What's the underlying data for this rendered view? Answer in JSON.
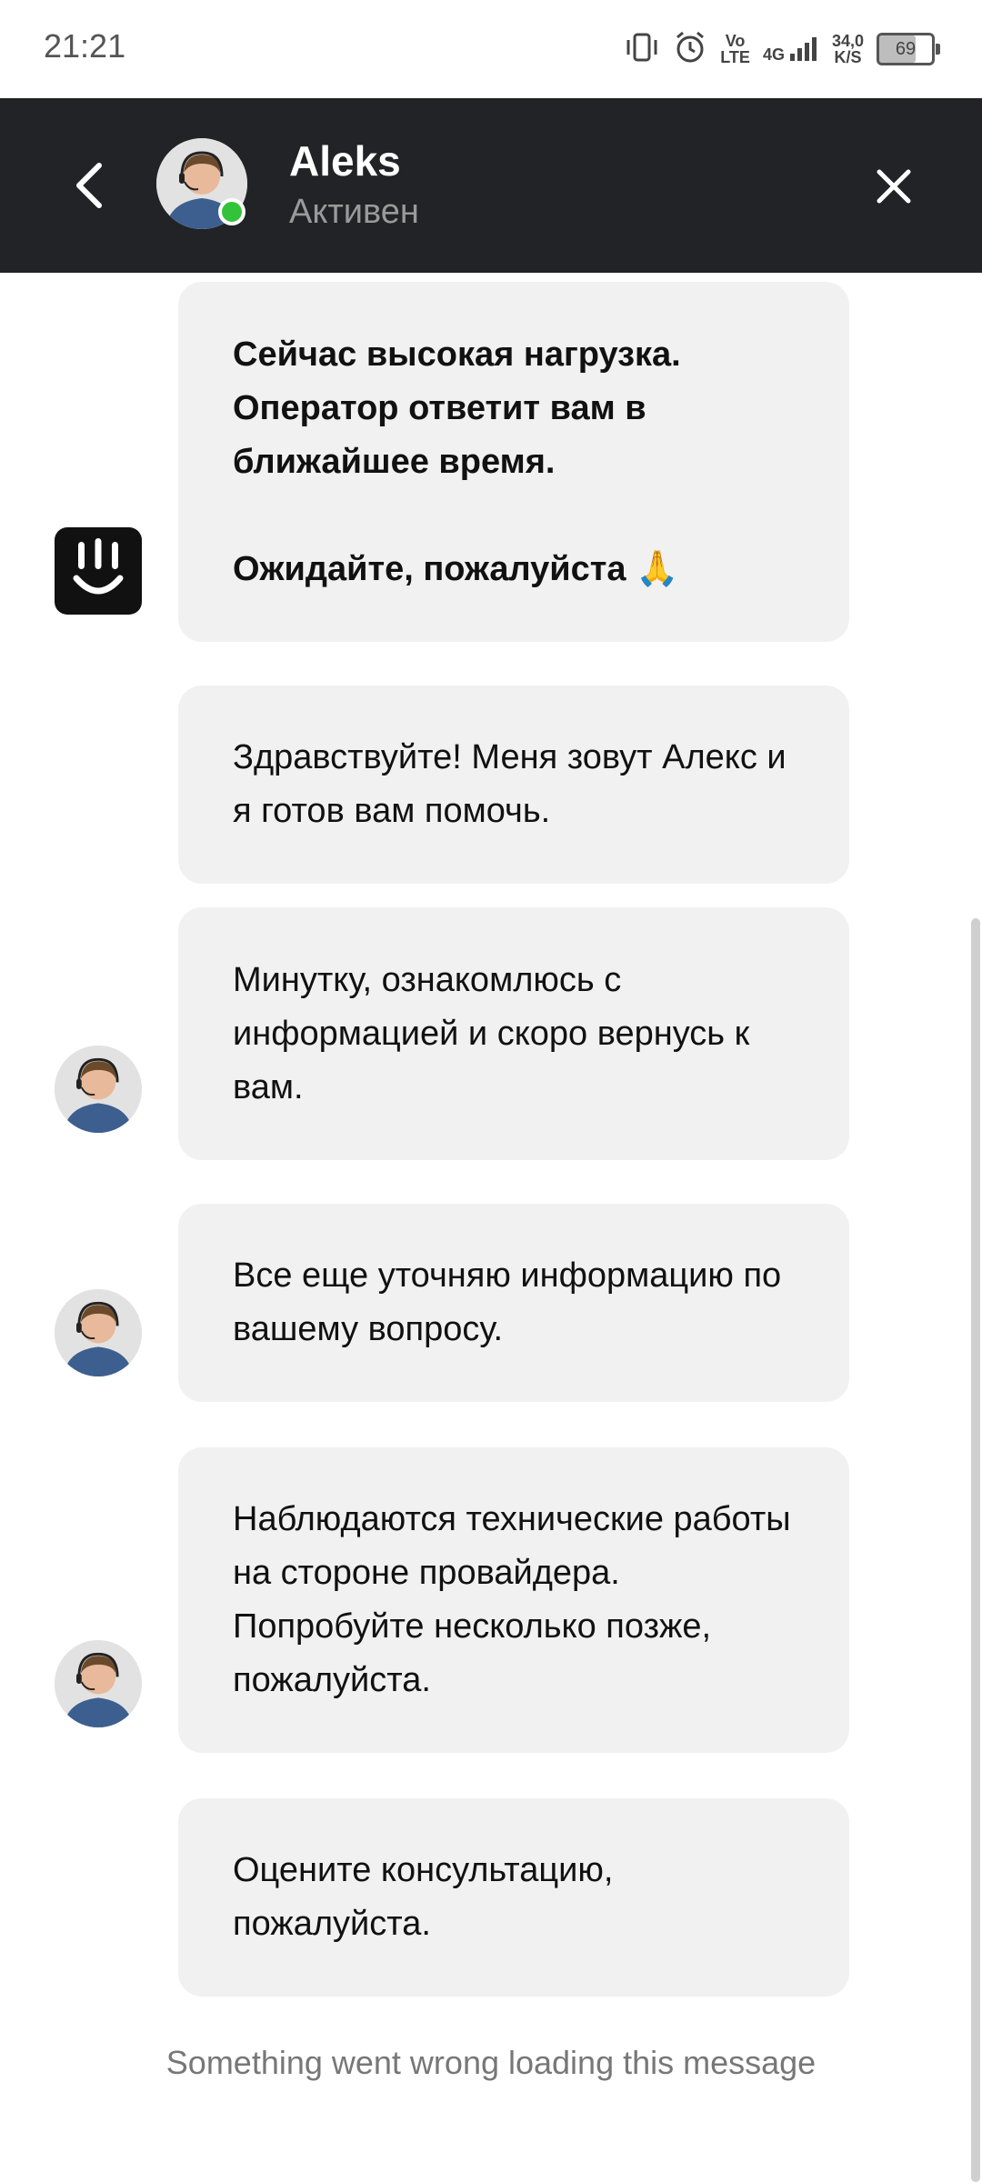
{
  "status_bar": {
    "time": "21:21",
    "network_top": "Vo",
    "network_bottom": "LTE",
    "signal_label": "4G",
    "speed_value": "34,0",
    "speed_unit": "K/S",
    "battery_level": "69"
  },
  "header": {
    "name": "Aleks",
    "status": "Активен",
    "online_color": "#33c33a"
  },
  "messages": [
    {
      "sender": "bot",
      "text": "Сейчас высокая нагрузка. Оператор ответит вам в ближайшее время.\n\nОжидайте, пожалуйста 🙏"
    },
    {
      "sender": "operator",
      "text": "Здравствуйте! Меня зовут Алекс и я готов вам помочь."
    },
    {
      "sender": "operator",
      "text": "Минутку, ознакомлюсь с информацией и скоро вернусь к вам."
    },
    {
      "sender": "operator",
      "text": "Все еще уточняю информацию по вашему вопросу."
    },
    {
      "sender": "operator",
      "text": "Наблюдаются технические работы на стороне провайдера. Попробуйте несколько позже, пожалуйста."
    },
    {
      "sender": "operator",
      "text": "Оцените консультацию, пожалуйста."
    }
  ],
  "error_message": "Something went wrong loading this message",
  "icons": {
    "back": "chevron-left-icon",
    "close": "close-icon",
    "bot": "bot-logo-icon"
  },
  "colors": {
    "header_bg": "#212326",
    "bubble_bg": "#f1f1f1"
  }
}
